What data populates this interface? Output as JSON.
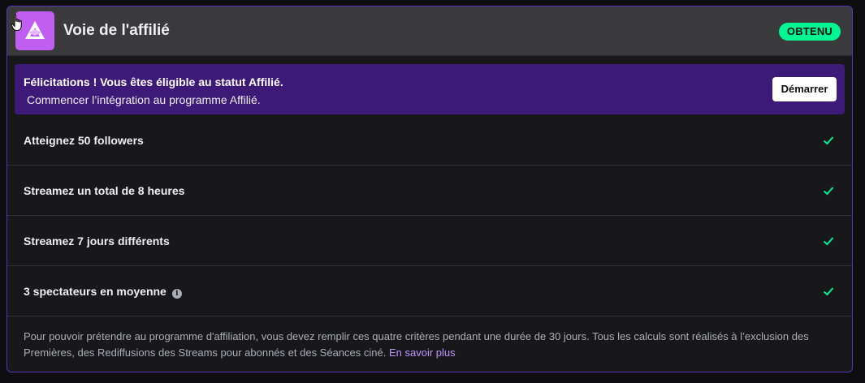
{
  "header": {
    "title": "Voie de l'affilié",
    "badge": "OBTENU",
    "icon": "affiliate-badge-icon"
  },
  "banner": {
    "title": "Félicitations ! Vous êtes éligible au statut Affilié.",
    "subtitle": "Commencer l’intégration au programme Affilié.",
    "button_label": "Démarrer"
  },
  "criteria": [
    {
      "label": "Atteignez 50 followers",
      "completed": true
    },
    {
      "label": "Streamez un total de 8 heures",
      "completed": true
    },
    {
      "label": "Streamez 7 jours différents",
      "completed": true
    },
    {
      "label": "3 spectateurs en moyenne",
      "completed": true,
      "info_icon": "info-icon"
    }
  ],
  "footnote": {
    "text": "Pour pouvoir prétendre au programme d'affiliation, vous devez remplir ces quatre critères pendant une durée de 30 jours. Tous les calculs sont réalisés à l’exclusion des Premières, des Rediffusions des Streams pour abonnés et des Séances ciné.",
    "link_label": "En savoir plus"
  },
  "colors": {
    "accent": "#bf5ef0",
    "banner_bg": "#3d1a78",
    "badge_bg": "#00f593",
    "check": "#00f593",
    "link": "#bf94ff",
    "card_border": "#5a34b8"
  }
}
